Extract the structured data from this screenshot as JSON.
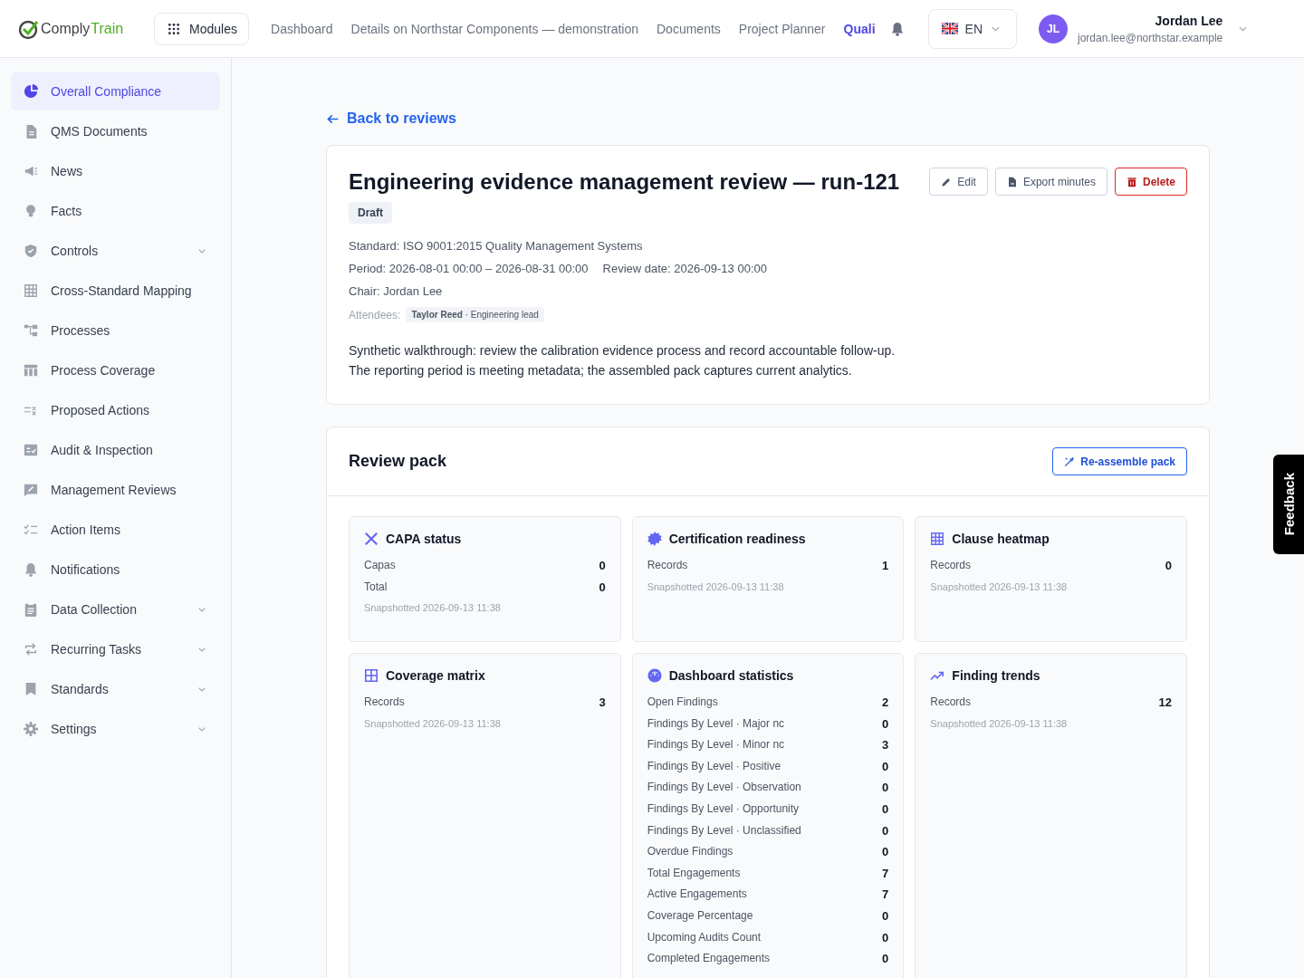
{
  "header": {
    "logo": {
      "part_1": "Comply",
      "part_2": "Train"
    },
    "modules_button": "Modules",
    "nav": [
      {
        "label": "Dashboard",
        "selected": false
      },
      {
        "label": "Details on Northstar Components — demonstration",
        "selected": false
      },
      {
        "label": "Documents",
        "selected": false
      },
      {
        "label": "Project Planner",
        "selected": false
      },
      {
        "label": "Quali",
        "selected": true
      }
    ],
    "language": "EN",
    "user": {
      "initials": "JL",
      "name": "Jordan Lee",
      "email": "jordan.lee@northstar.example"
    }
  },
  "sidebar": {
    "items": [
      {
        "label": "Overall Compliance",
        "selected": true,
        "expandable": false
      },
      {
        "label": "QMS Documents",
        "selected": false,
        "expandable": false
      },
      {
        "label": "News",
        "selected": false,
        "expandable": false
      },
      {
        "label": "Facts",
        "selected": false,
        "expandable": false
      },
      {
        "label": "Controls",
        "selected": false,
        "expandable": true
      },
      {
        "label": "Cross-Standard Mapping",
        "selected": false,
        "expandable": false
      },
      {
        "label": "Processes",
        "selected": false,
        "expandable": false
      },
      {
        "label": "Process Coverage",
        "selected": false,
        "expandable": false
      },
      {
        "label": "Proposed Actions",
        "selected": false,
        "expandable": false
      },
      {
        "label": "Audit & Inspection",
        "selected": false,
        "expandable": false
      },
      {
        "label": "Management Reviews",
        "selected": false,
        "expandable": false
      },
      {
        "label": "Action Items",
        "selected": false,
        "expandable": false
      },
      {
        "label": "Notifications",
        "selected": false,
        "expandable": false
      },
      {
        "label": "Data Collection",
        "selected": false,
        "expandable": true
      },
      {
        "label": "Recurring Tasks",
        "selected": false,
        "expandable": true
      },
      {
        "label": "Standards",
        "selected": false,
        "expandable": true
      },
      {
        "label": "Settings",
        "selected": false,
        "expandable": true
      }
    ]
  },
  "back_link": "Back to reviews",
  "review": {
    "title": "Engineering evidence management review — run-121",
    "status": "Draft",
    "buttons": [
      {
        "label": "Edit",
        "kind": "pencil"
      },
      {
        "label": "Export minutes",
        "kind": "pdf"
      },
      {
        "label": "Delete",
        "kind": "trash"
      }
    ],
    "standard": "Standard: ISO 9001:2015 Quality Management Systems",
    "period": "Period: 2026-08-01 00:00 – 2026-08-31 00:00",
    "review_date": "Review date: 2026-09-13 00:00",
    "chair": "Chair: Jordan Lee",
    "attendees_label": "Attendees:",
    "attendees": [
      {
        "name": "Taylor Reed",
        "role": "· Engineering lead"
      }
    ],
    "description": "Synthetic walkthrough: review the calibration evidence process and record accountable follow-up. The reporting period is meeting metadata; the assembled pack captures current analytics."
  },
  "review_pack": {
    "title": "Review pack",
    "reassemble_button": "Re-assemble pack",
    "widgets": [
      {
        "title": "CAPA status",
        "rows": [
          {
            "label": "Capas",
            "value": "0"
          },
          {
            "label": "Total",
            "value": "0"
          }
        ],
        "snapshot": "Snapshotted 2026-09-13 11:38"
      },
      {
        "title": "Certification readiness",
        "rows": [
          {
            "label": "Records",
            "value": "1"
          }
        ],
        "snapshot": "Snapshotted 2026-09-13 11:38"
      },
      {
        "title": "Clause heatmap",
        "rows": [
          {
            "label": "Records",
            "value": "0"
          }
        ],
        "snapshot": "Snapshotted 2026-09-13 11:38"
      },
      {
        "title": "Coverage matrix",
        "rows": [
          {
            "label": "Records",
            "value": "3"
          }
        ],
        "snapshot": "Snapshotted 2026-09-13 11:38"
      },
      {
        "title": "Dashboard statistics",
        "rows": [
          {
            "label": "Open Findings",
            "value": "2"
          },
          {
            "label": "Findings By Level · Major nc",
            "value": "0"
          },
          {
            "label": "Findings By Level · Minor nc",
            "value": "3"
          },
          {
            "label": "Findings By Level · Positive",
            "value": "0"
          },
          {
            "label": "Findings By Level · Observation",
            "value": "0"
          },
          {
            "label": "Findings By Level · Opportunity",
            "value": "0"
          },
          {
            "label": "Findings By Level · Unclassified",
            "value": "0"
          },
          {
            "label": "Overdue Findings",
            "value": "0"
          },
          {
            "label": "Total Engagements",
            "value": "7"
          },
          {
            "label": "Active Engagements",
            "value": "7"
          },
          {
            "label": "Coverage Percentage",
            "value": "0"
          },
          {
            "label": "Upcoming Audits Count",
            "value": "0"
          },
          {
            "label": "Completed Engagements",
            "value": "0"
          }
        ]
      },
      {
        "title": "Finding trends",
        "rows": [
          {
            "label": "Records",
            "value": "12"
          }
        ],
        "snapshot": "Snapshotted 2026-09-13 11:38"
      }
    ]
  },
  "feedback_tab": "Feedback"
}
